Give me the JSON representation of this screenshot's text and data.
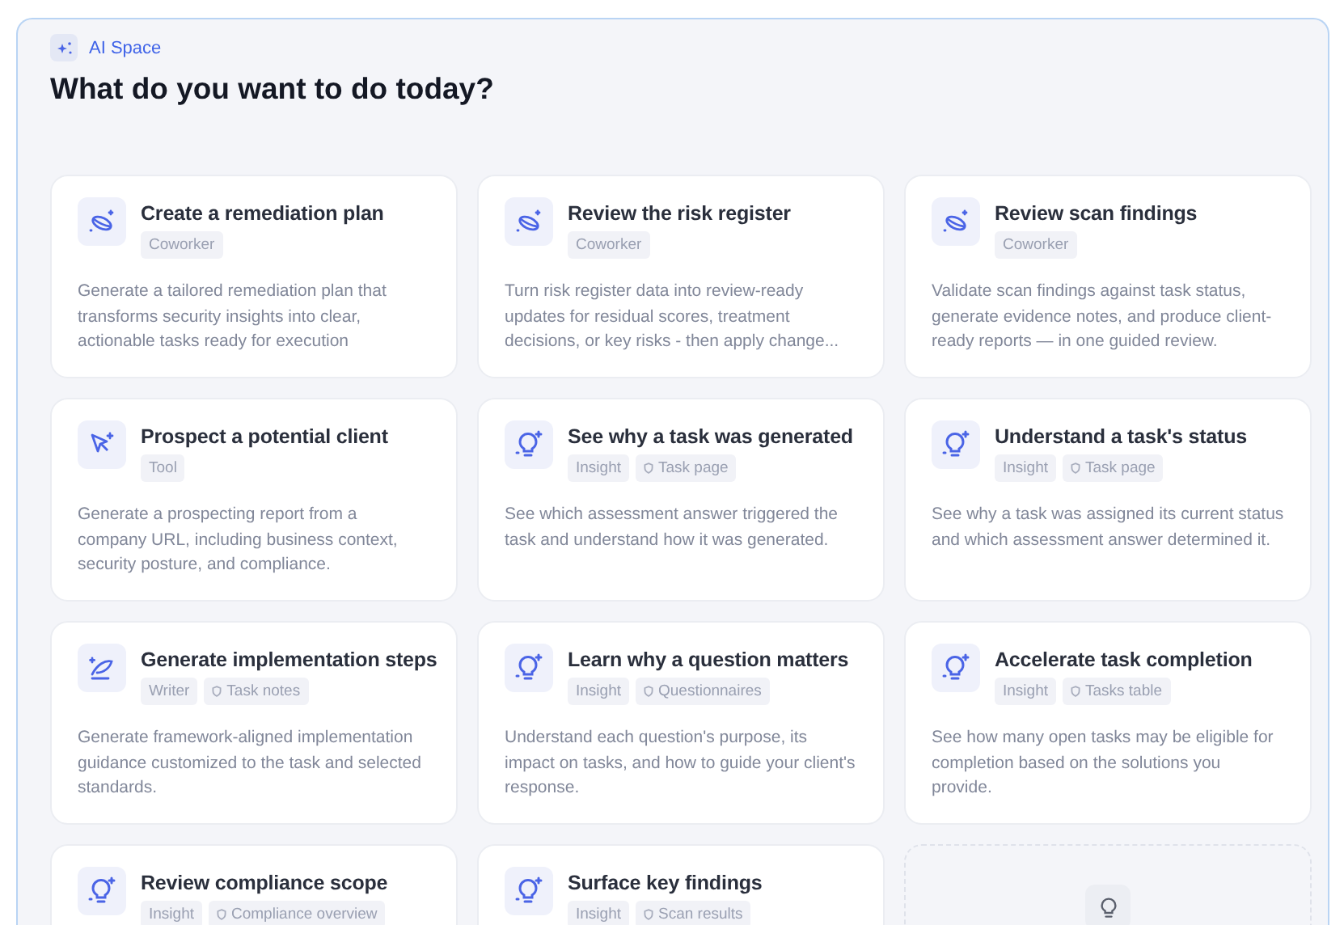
{
  "header": {
    "badge": "AI Space",
    "title": "What do you want to do today?"
  },
  "cards": [
    {
      "kind": "coworker",
      "title": "Create a remediation plan",
      "tags": [
        {
          "label": "Coworker",
          "kind": "type"
        }
      ],
      "description": "Generate a tailored remediation plan that transforms security insights into clear, actionable tasks ready for execution"
    },
    {
      "kind": "coworker",
      "title": "Review the risk register",
      "tags": [
        {
          "label": "Coworker",
          "kind": "type"
        }
      ],
      "description": "Turn risk register data into review-ready updates for residual scores, treatment decisions, or key risks - then apply change..."
    },
    {
      "kind": "coworker",
      "title": "Review scan findings",
      "tags": [
        {
          "label": "Coworker",
          "kind": "type"
        }
      ],
      "description": "Validate scan findings against task status, generate evidence notes, and produce client-ready reports — in one guided review."
    },
    {
      "kind": "tool",
      "title": "Prospect a potential client",
      "tags": [
        {
          "label": "Tool",
          "kind": "type"
        }
      ],
      "description": "Generate a prospecting report from a company URL, including business context, security posture, and compliance."
    },
    {
      "kind": "insight",
      "title": "See why a task was generated",
      "tags": [
        {
          "label": "Insight",
          "kind": "type"
        },
        {
          "label": "Task page",
          "kind": "location"
        }
      ],
      "description": "See which assessment answer triggered the task and understand how it was generated."
    },
    {
      "kind": "insight",
      "title": "Understand a task's status",
      "tags": [
        {
          "label": "Insight",
          "kind": "type"
        },
        {
          "label": "Task page",
          "kind": "location"
        }
      ],
      "description": "See why a task was assigned its current status and which assessment answer determined it."
    },
    {
      "kind": "writer",
      "title": "Generate implementation steps",
      "tags": [
        {
          "label": "Writer",
          "kind": "type"
        },
        {
          "label": "Task notes",
          "kind": "location"
        }
      ],
      "description": "Generate framework-aligned implementation guidance customized to the task and selected standards."
    },
    {
      "kind": "insight",
      "title": "Learn why a question matters",
      "tags": [
        {
          "label": "Insight",
          "kind": "type"
        },
        {
          "label": "Questionnaires",
          "kind": "location"
        }
      ],
      "description": "Understand each question's purpose, its impact on tasks, and how to guide your client's response."
    },
    {
      "kind": "insight",
      "title": "Accelerate task completion",
      "tags": [
        {
          "label": "Insight",
          "kind": "type"
        },
        {
          "label": "Tasks table",
          "kind": "location"
        }
      ],
      "description": "See how many open tasks may be eligible for completion based on the solutions you provide."
    },
    {
      "kind": "insight",
      "title": "Review compliance scope",
      "tags": [
        {
          "label": "Insight",
          "kind": "type"
        },
        {
          "label": "Compliance overview",
          "kind": "location"
        }
      ]
    },
    {
      "kind": "insight",
      "title": "Surface key findings",
      "tags": [
        {
          "label": "Insight",
          "kind": "type"
        },
        {
          "label": "Scan results",
          "kind": "location"
        }
      ]
    },
    {
      "kind": "placeholder"
    }
  ]
}
